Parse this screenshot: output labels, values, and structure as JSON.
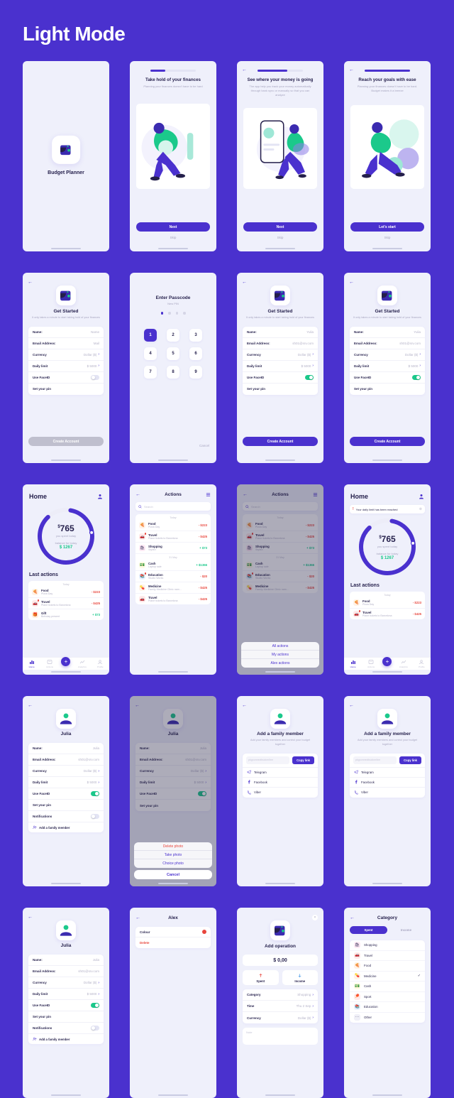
{
  "page": {
    "title": "Light Mode",
    "accent": "#4A31CE",
    "background": "#4A31CE",
    "green": "#1BC98B",
    "red": "#E8453C"
  },
  "splash": {
    "app_name": "Budget Planner"
  },
  "onboarding": [
    {
      "title": "Take hold of your finances",
      "subtitle": "Planning your finances doesn't have to be hard",
      "button": "Next",
      "skip": "Skip",
      "progress": 33
    },
    {
      "title": "See where your money is going",
      "subtitle": "The app help you track your money automatically through bank sync or manually so that you can analyze",
      "button": "Next",
      "skip": "Skip",
      "progress": 66
    },
    {
      "title": "Reach your goals with ease",
      "subtitle": "Planning your finances doesn't have to be hard. Budget makes it a breeze",
      "button": "Let's start",
      "skip": "Skip",
      "progress": 100
    }
  ],
  "get_started": {
    "title": "Get Started",
    "subtitle": "It only takes a minute to start taking hold of your finances",
    "fields_empty": [
      {
        "label": "Name:",
        "value": "Name"
      },
      {
        "label": "Email Address:",
        "value": "Mail"
      },
      {
        "label": "Currency",
        "value": "Dollar ($)"
      },
      {
        "label": "Daily limit",
        "value": "$ 5000"
      },
      {
        "label": "Use FaceID",
        "value": ""
      },
      {
        "label": "Set your pin",
        "value": ""
      }
    ],
    "fields_filled": [
      {
        "label": "Name:",
        "value": "Yulia"
      },
      {
        "label": "Email Address:",
        "value": "sh01@srv.com"
      },
      {
        "label": "Currency",
        "value": "Dollar ($)"
      },
      {
        "label": "Daily limit",
        "value": "$ 5000"
      },
      {
        "label": "Use FaceID",
        "value": ""
      },
      {
        "label": "Set your pin",
        "value": ""
      }
    ],
    "cta_disabled": "Create Account",
    "cta_enabled": "Create Account"
  },
  "passcode": {
    "title": "Enter Passcode",
    "subtitle": "New PIN",
    "keys": [
      "1",
      "2",
      "3",
      "4",
      "5",
      "6",
      "7",
      "8",
      "9"
    ],
    "active_key": "1",
    "cancel": "Cancel",
    "dots_filled": 1,
    "dots_total": 4
  },
  "home": {
    "title": "Home",
    "alert": "Your daily limit has been reached",
    "spent_amount": "765",
    "spent_currency": "$",
    "spent_caption": "you spent today",
    "balance_caption": "balance for today",
    "balance_amount": "$ 1267",
    "section": "Last actions",
    "day_label": "Today",
    "transactions": [
      {
        "name": "Food",
        "desc": "Pizza Day",
        "amount": "- $223",
        "sign": "neg",
        "icon": "pizza-icon",
        "color": "#FFF1E6",
        "glyph": "🍕",
        "badge": false
      },
      {
        "name": "Travel",
        "desc": "Plane tickets to Barcelona",
        "amount": "- $425",
        "sign": "neg",
        "icon": "car-icon",
        "color": "#FFE9E9",
        "glyph": "🚗",
        "badge": true
      },
      {
        "name": "Gift",
        "desc": "Birthday present",
        "amount": "+ $73",
        "sign": "pos",
        "icon": "gift-icon",
        "color": "#FFEEDD",
        "glyph": "🎁",
        "badge": false
      }
    ],
    "tabs": [
      {
        "label": "Home",
        "icon": "chart-icon",
        "active": true
      },
      {
        "label": "Actions",
        "icon": "list-icon",
        "active": false
      },
      {
        "label": "Add",
        "icon": "plus-icon",
        "active": false
      },
      {
        "label": "Analytics",
        "icon": "stats-icon",
        "active": false
      },
      {
        "label": "Profile",
        "icon": "person-icon",
        "active": false
      }
    ]
  },
  "actions": {
    "title": "Actions",
    "search_placeholder": "Search",
    "groups": [
      {
        "day": "Today",
        "items": [
          {
            "name": "Food",
            "desc": "Pizza Day",
            "amount": "- $223",
            "sign": "neg",
            "color": "#FFF1E6",
            "glyph": "🍕",
            "badge": false
          },
          {
            "name": "Travel",
            "desc": "Plane tickets to Barcelona",
            "amount": "- $425",
            "sign": "neg",
            "color": "#FFE9E9",
            "glyph": "🚗",
            "badge": true
          },
          {
            "name": "Shopping",
            "desc": "Stylish",
            "amount": "+ $73",
            "sign": "pos",
            "color": "#FDE9F4",
            "glyph": "🛍",
            "badge": false
          }
        ]
      },
      {
        "day": "31 May",
        "items": [
          {
            "name": "Cash",
            "desc": "Laptop sale",
            "amount": "+ $1366",
            "sign": "pos",
            "color": "#FFFBE3",
            "glyph": "💵",
            "badge": false
          },
          {
            "name": "Education",
            "desc": "Studio Works",
            "amount": "- $20",
            "sign": "neg",
            "color": "#E9F2FF",
            "glyph": "📚",
            "badge": true
          },
          {
            "name": "Medicine",
            "desc": "Family Medicine Clinic nam...",
            "amount": "- $425",
            "sign": "neg",
            "color": "#FFF3E8",
            "glyph": "💊",
            "badge": false
          },
          {
            "name": "Travel",
            "desc": "Plane tickets to Barcelona",
            "amount": "- $425",
            "sign": "neg",
            "color": "#FFE9E9",
            "glyph": "🚗",
            "badge": false
          }
        ]
      }
    ],
    "filter_sheet": [
      "All actions",
      "My actions",
      "Alex actions"
    ]
  },
  "profile": {
    "name": "Julia",
    "fields": [
      {
        "label": "Name:",
        "value": "Julia"
      },
      {
        "label": "Email Address:",
        "value": "sh01@srv.com"
      },
      {
        "label": "Currency",
        "value": "Dollar ($)"
      },
      {
        "label": "Daily limit",
        "value": "$ 5000"
      },
      {
        "label": "Use FaceID",
        "value": ""
      },
      {
        "label": "Set your pin",
        "value": ""
      },
      {
        "label": "Notifications",
        "value": ""
      }
    ],
    "add_family": "Add a family member",
    "photo_sheet": [
      "Delete photo",
      "Take photo",
      "Choice photo"
    ],
    "photo_cancel": "Cancel"
  },
  "add_family": {
    "title": "Add a family member",
    "subtitle": "Add your family members and control your budget together",
    "link_placeholder": "pkgconnectbudcm/bm",
    "copy_button": "Copy link",
    "socials": [
      {
        "label": "Telegram",
        "icon": "telegram-icon"
      },
      {
        "label": "Facebook",
        "icon": "facebook-icon"
      },
      {
        "label": "Viber",
        "icon": "viber-icon"
      }
    ]
  },
  "member": {
    "title": "Alex",
    "colour_label": "Colour",
    "colour_value": "#E8453C",
    "delete_label": "Delete"
  },
  "add_operation": {
    "title": "Add operation",
    "amount": "$ 0,00",
    "segments": [
      {
        "label": "Spent",
        "icon": "arrow-up-icon"
      },
      {
        "label": "Income",
        "icon": "arrow-down-icon"
      }
    ],
    "fields": [
      {
        "label": "Category",
        "value": "Shopping"
      },
      {
        "label": "Time",
        "value": "Thu 2 Sep"
      },
      {
        "label": "Currency",
        "value": "Dollar ($)"
      }
    ],
    "note_placeholder": "Note"
  },
  "category": {
    "title": "Category",
    "tabs": [
      {
        "label": "Spent",
        "active": true
      },
      {
        "label": "Income",
        "active": false
      }
    ],
    "items": [
      {
        "label": "Shopping",
        "glyph": "🛍",
        "color": "#FDE9F4",
        "checked": false
      },
      {
        "label": "Travel",
        "glyph": "🚗",
        "color": "#FFE9E9",
        "checked": false
      },
      {
        "label": "Food",
        "glyph": "🍕",
        "color": "#FFF1E6",
        "checked": false
      },
      {
        "label": "Medicine",
        "glyph": "💊",
        "color": "#FFF3E8",
        "checked": true
      },
      {
        "label": "Cash",
        "glyph": "💵",
        "color": "#FFFBE3",
        "checked": false
      },
      {
        "label": "Sport",
        "glyph": "🏓",
        "color": "#FFE9E9",
        "checked": false
      },
      {
        "label": "Education",
        "glyph": "📚",
        "color": "#E9F2FF",
        "checked": false
      },
      {
        "label": "Other",
        "glyph": "⋯",
        "color": "#EFEFF7",
        "checked": false
      }
    ]
  }
}
